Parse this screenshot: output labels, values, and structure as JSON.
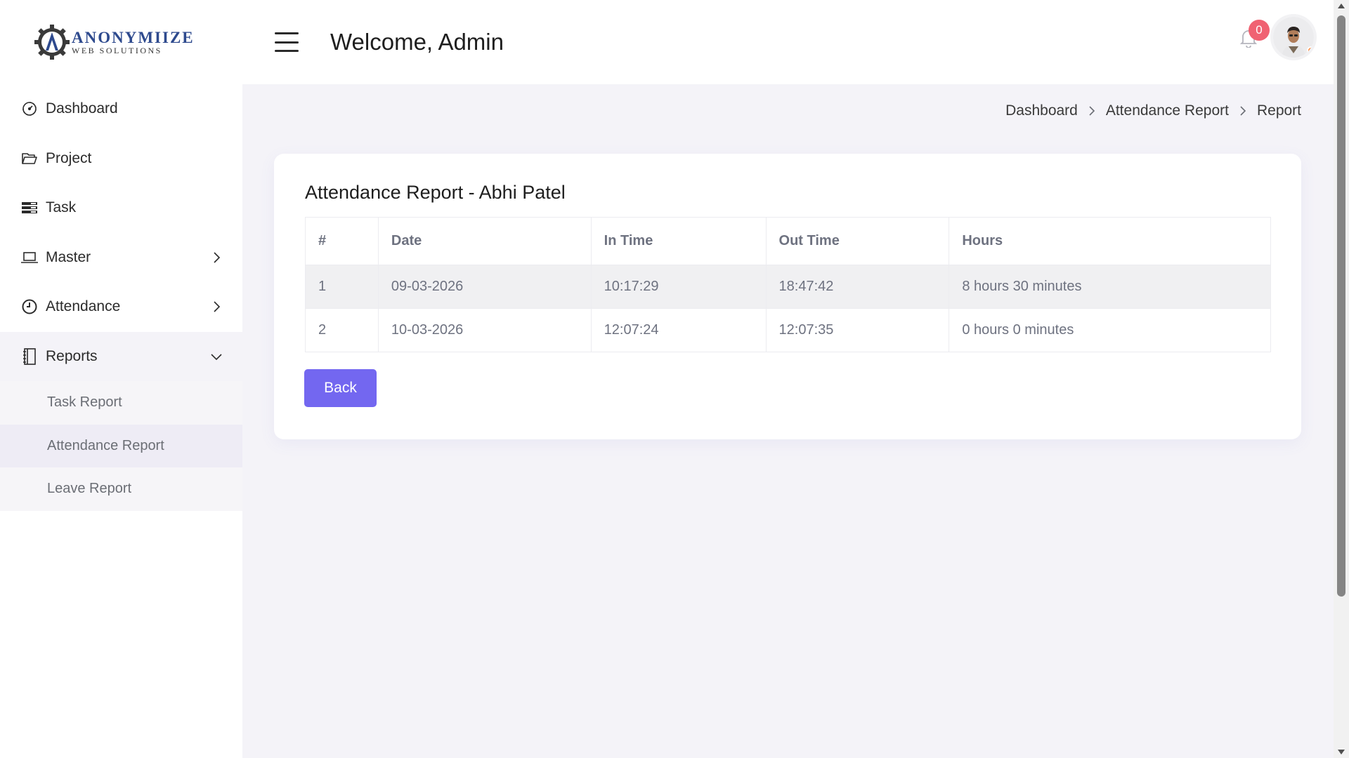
{
  "brand": {
    "name": "ANONYMIIZE",
    "tagline": "WEB SOLUTIONS"
  },
  "header": {
    "welcome": "Welcome, Admin",
    "notifications_count": "0"
  },
  "sidebar": {
    "items": [
      {
        "label": "Dashboard",
        "icon": "dashboard-gauge-icon"
      },
      {
        "label": "Project",
        "icon": "folder-open-icon"
      },
      {
        "label": "Task",
        "icon": "task-list-icon"
      },
      {
        "label": "Master",
        "icon": "laptop-icon",
        "expandable": true
      },
      {
        "label": "Attendance",
        "icon": "clock-icon",
        "expandable": true
      },
      {
        "label": "Reports",
        "icon": "notebook-icon",
        "expandable": true,
        "expanded": true
      }
    ],
    "reports_sub": [
      {
        "label": "Task Report"
      },
      {
        "label": "Attendance Report",
        "active": true
      },
      {
        "label": "Leave Report"
      }
    ]
  },
  "breadcrumb": [
    "Dashboard",
    "Attendance Report",
    "Report"
  ],
  "report": {
    "title": "Attendance Report - Abhi Patel",
    "columns": [
      "#",
      "Date",
      "In Time",
      "Out Time",
      "Hours"
    ],
    "rows": [
      [
        "1",
        "09-03-2026",
        "10:17:29",
        "18:47:42",
        "8 hours 30 minutes"
      ],
      [
        "2",
        "10-03-2026",
        "12:07:24",
        "12:07:35",
        "0 hours 0 minutes"
      ]
    ],
    "back_label": "Back"
  },
  "colors": {
    "primary": "#7367f0",
    "badge": "#f06272",
    "background": "#f4f3f8"
  }
}
